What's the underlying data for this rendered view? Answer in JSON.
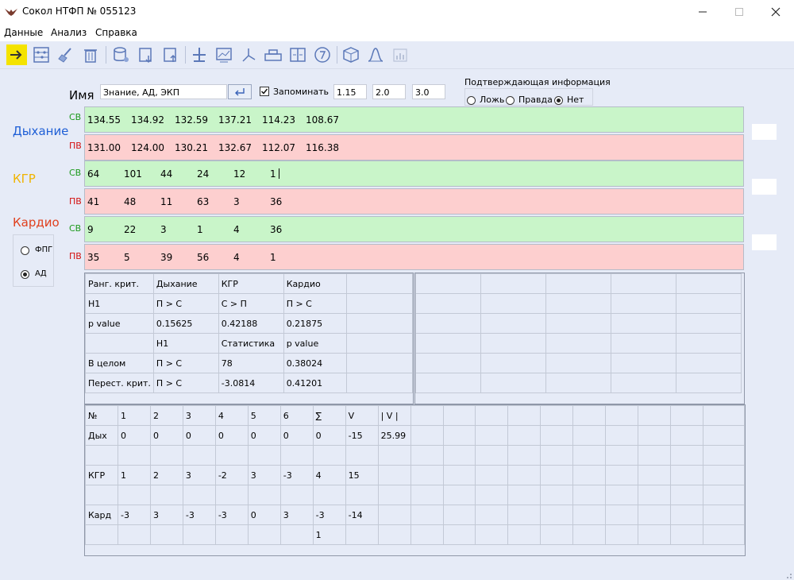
{
  "window": {
    "title": "Сокол НТФП  № 055123",
    "icon": "bird-logo-icon"
  },
  "menu": [
    "Данные",
    "Анализ",
    "Справка"
  ],
  "toolbar_icons": [
    "arrow-right-icon",
    "abacus-icon",
    "broom-icon",
    "trash-icon",
    "database-gear-icon",
    "database-import-icon",
    "database-export-icon",
    "stand-icon",
    "chart-icon",
    "axes-icon",
    "bar-blocks-icon",
    "split-columns-icon",
    "clock-seven-icon",
    "dice-icon",
    "curve-icon",
    "bar-chart-disabled-icon"
  ],
  "form": {
    "name_label": "Имя",
    "name_value": "Знание, АД, ЭКП",
    "remember_label": "Запоминать",
    "remember_checked": true,
    "param1": "1.15",
    "param2": "2.0",
    "param3": "3.0",
    "confirm": {
      "title": "Подтверждающая информация",
      "options": [
        "Ложь",
        "Правда",
        "Нет"
      ],
      "selected": "Нет"
    }
  },
  "side": {
    "breathing": "Дыхание",
    "kgr": "КГР",
    "cardio": "Кардио",
    "cardio_modes": [
      "ФПГ",
      "АД"
    ],
    "cardio_selected": "АД",
    "colors": {
      "breathing": "#1f5fd6",
      "kgr": "#f0b400",
      "cardio": "#e0401e"
    }
  },
  "rows": [
    {
      "tag": "СВ",
      "kind": "green",
      "values": [
        "134.55",
        "134.92",
        "132.59",
        "137.21",
        "114.23",
        "108.67"
      ]
    },
    {
      "tag": "ПВ",
      "kind": "red",
      "values": [
        "131.00",
        "124.00",
        "130.21",
        "132.67",
        "112.07",
        "116.38"
      ]
    },
    {
      "tag": "СВ",
      "kind": "green",
      "values": [
        "64",
        "101",
        "44",
        "24",
        "12",
        "1"
      ]
    },
    {
      "tag": "ПВ",
      "kind": "red",
      "values": [
        "41",
        "48",
        "11",
        "63",
        "3",
        "36"
      ]
    },
    {
      "tag": "СВ",
      "kind": "green",
      "values": [
        "9",
        "22",
        "3",
        "1",
        "4",
        "36"
      ]
    },
    {
      "tag": "ПВ",
      "kind": "red",
      "values": [
        "35",
        "5",
        "39",
        "56",
        "4",
        "1"
      ]
    }
  ],
  "rank_table": [
    [
      "Ранг. крит.",
      "Дыхание",
      "КГР",
      "Кардио",
      ""
    ],
    [
      "H1",
      "П > С",
      "С > П",
      "П > С",
      ""
    ],
    [
      "p value",
      "0.15625",
      "0.42188",
      "0.21875",
      ""
    ],
    [
      "",
      "H1",
      "Статистика",
      "p value",
      ""
    ],
    [
      "В целом",
      "П > С",
      "78",
      "0.38024",
      ""
    ],
    [
      "Перест. крит.",
      "П > С",
      "-3.0814",
      "0.41201",
      ""
    ]
  ],
  "score_table": [
    [
      "№",
      "1",
      "2",
      "3",
      "4",
      "5",
      "6",
      "∑",
      "V",
      "| V |",
      "",
      "",
      "",
      "",
      "",
      "",
      "",
      "",
      "",
      ""
    ],
    [
      "Дых",
      "0",
      "0",
      "0",
      "0",
      "0",
      "0",
      "0",
      "-15",
      "25.99",
      "",
      "",
      "",
      "",
      "",
      "",
      "",
      "",
      "",
      ""
    ],
    [
      "",
      "",
      "",
      "",
      "",
      "",
      "",
      "",
      "",
      "",
      "",
      "",
      "",
      "",
      "",
      "",
      "",
      "",
      "",
      ""
    ],
    [
      "КГР",
      "1",
      "2",
      "3",
      "-2",
      "3",
      "-3",
      "4",
      "15",
      "",
      "",
      "",
      "",
      "",
      "",
      "",
      "",
      "",
      "",
      ""
    ],
    [
      "",
      "",
      "",
      "",
      "",
      "",
      "",
      "",
      "",
      "",
      "",
      "",
      "",
      "",
      "",
      "",
      "",
      "",
      "",
      ""
    ],
    [
      "Кард",
      "-3",
      "3",
      "-3",
      "-3",
      "0",
      "3",
      "-3",
      "-14",
      "",
      "",
      "",
      "",
      "",
      "",
      "",
      "",
      "",
      "",
      ""
    ],
    [
      "",
      "",
      "",
      "",
      "",
      "",
      "",
      "1",
      "",
      "",
      "",
      "",
      "",
      "",
      "",
      "",
      "",
      "",
      "",
      ""
    ]
  ]
}
